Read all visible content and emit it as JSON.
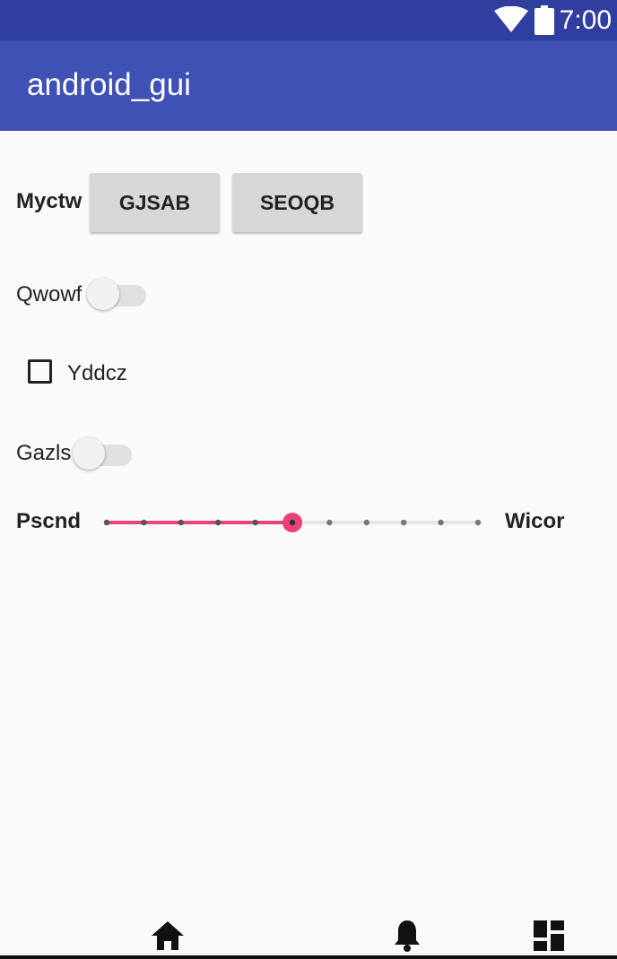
{
  "status_bar": {
    "time": "7:00",
    "icons": [
      "wifi-icon",
      "battery-icon"
    ]
  },
  "app_bar": {
    "title": "android_gui"
  },
  "row1": {
    "label": "Myctw",
    "button1": "GJSAB",
    "button2": "SEOQB"
  },
  "switch1": {
    "label": "Qwowf",
    "checked": false
  },
  "checkbox1": {
    "label": "Yddcz",
    "checked": false
  },
  "switch2": {
    "label": "Gazls",
    "checked": false
  },
  "slider1": {
    "label_left": "Pscnd",
    "label_right": "Wicor",
    "steps": 10,
    "value": 5,
    "accent": "#ec407a"
  },
  "bottom_nav": {
    "icons": [
      "home-icon",
      "bell-icon",
      "dashboard-icon"
    ]
  },
  "colors": {
    "primary": "#3f51b5",
    "primary_dark": "#303f9f",
    "background": "#fafafa"
  }
}
